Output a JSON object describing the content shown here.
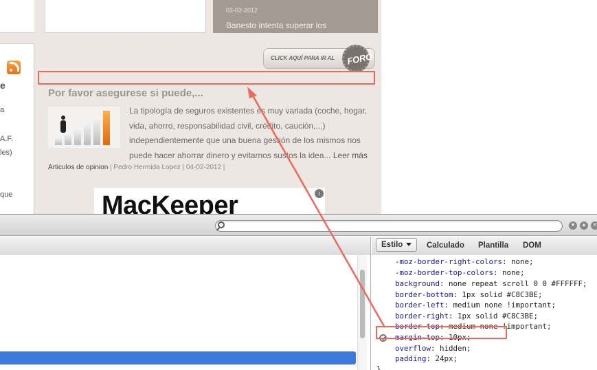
{
  "colors": {
    "annotation_red": "#ea6b5c",
    "page_beige": "#ece7e3",
    "news_card": "#a39a93",
    "selection_blue": "#3b7adb"
  },
  "left_sidebar": {
    "icon": "rss-icon",
    "heading": "e",
    "lines": [
      "a",
      "A.F.",
      "les)",
      "que"
    ]
  },
  "news": {
    "date": "03-02-2012",
    "title": "Banesto intenta superar los"
  },
  "forum_button": {
    "label": "CLICK AQUÍ PARA IR AL",
    "badge": "FORO"
  },
  "article": {
    "title": "Por favor asegurese si puede,...",
    "body": "La tipología de seguros existentes es muy variada (coche, hogar, vida, ahorro, responsabilidad civil, crédito, caución,...) independientemente que una buena gestión de los mismos nos puede hacer ahorrar dinero y evitarnos sustos la idea...",
    "read_more": "Leer más",
    "category": "Articulos de opinion",
    "meta": " | Pedro Hermida Lopez | 04-02-2012 |"
  },
  "ad": {
    "text": "MacKeeper",
    "info": "i"
  },
  "devtools": {
    "search_placeholder": "",
    "tabs": {
      "styles": "Estilo",
      "computed": "Calculado",
      "template": "Plantilla",
      "dom": "DOM"
    },
    "css_rules": [
      {
        "prop": "-moz-border-right-colors",
        "value": "none;"
      },
      {
        "prop": "-moz-border-top-colors",
        "value": "none;"
      },
      {
        "prop": "background",
        "value": "none repeat scroll 0 0 #FFFFFF;"
      },
      {
        "prop": "border-bottom",
        "value": "1px solid #C8C3BE;"
      },
      {
        "prop": "border-left",
        "value": "medium none !important;"
      },
      {
        "prop": "border-right",
        "value": "1px solid #C8C3BE;"
      },
      {
        "prop": "border-top",
        "value": "medium none !important;"
      },
      {
        "prop": "margin-top",
        "value": "10px;",
        "disabled": true
      },
      {
        "prop": "overflow",
        "value": "hidden;"
      },
      {
        "prop": "padding",
        "value": "24px;"
      }
    ],
    "closing_brace": "}"
  }
}
